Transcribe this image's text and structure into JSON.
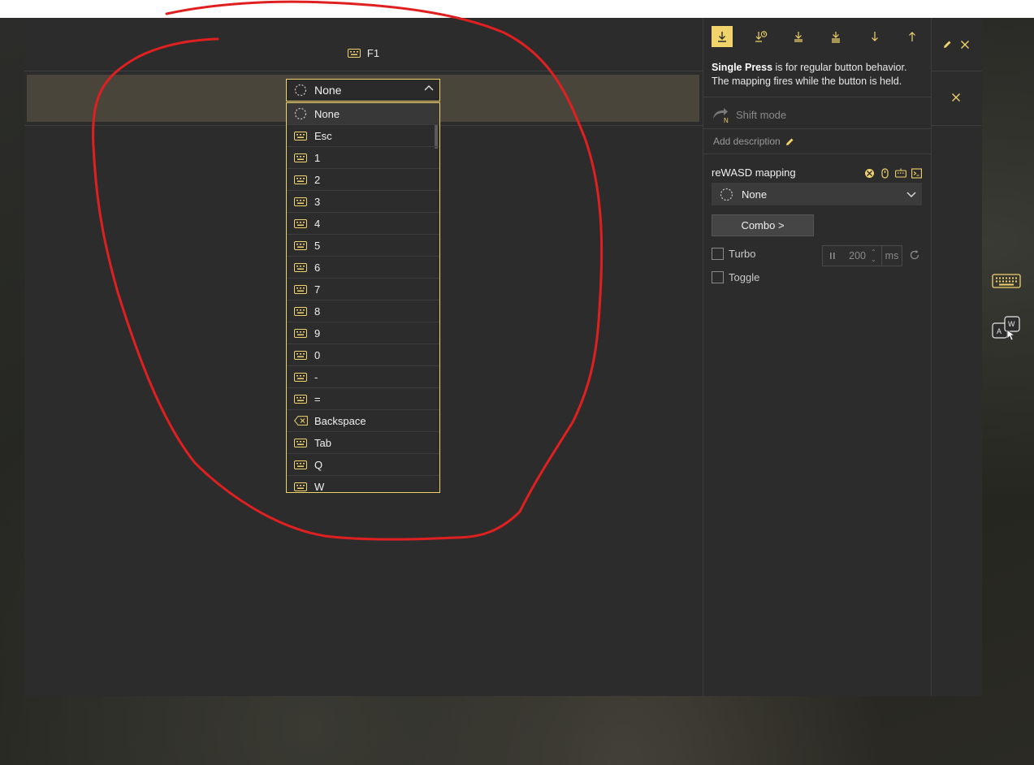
{
  "header": {
    "key_label": "F1"
  },
  "mapping_select": {
    "value": "None"
  },
  "dropdown": {
    "items": [
      {
        "label": "None",
        "icon": "dotted-circle-icon",
        "selected": true
      },
      {
        "label": "Esc",
        "icon": "keyboard-icon"
      },
      {
        "label": "1",
        "icon": "keyboard-icon"
      },
      {
        "label": "2",
        "icon": "keyboard-icon"
      },
      {
        "label": "3",
        "icon": "keyboard-icon"
      },
      {
        "label": "4",
        "icon": "keyboard-icon"
      },
      {
        "label": "5",
        "icon": "keyboard-icon"
      },
      {
        "label": "6",
        "icon": "keyboard-icon"
      },
      {
        "label": "7",
        "icon": "keyboard-icon"
      },
      {
        "label": "8",
        "icon": "keyboard-icon"
      },
      {
        "label": "9",
        "icon": "keyboard-icon"
      },
      {
        "label": "0",
        "icon": "keyboard-icon"
      },
      {
        "label": "-",
        "icon": "keyboard-icon"
      },
      {
        "label": "=",
        "icon": "keyboard-icon"
      },
      {
        "label": "Backspace",
        "icon": "backspace-icon"
      },
      {
        "label": "Tab",
        "icon": "keyboard-icon"
      },
      {
        "label": "Q",
        "icon": "keyboard-icon"
      },
      {
        "label": "W",
        "icon": "keyboard-icon"
      }
    ]
  },
  "side_panel": {
    "mode_buttons": [
      {
        "name": "single-press",
        "active": true
      },
      {
        "name": "long-press"
      },
      {
        "name": "double-press"
      },
      {
        "name": "triple-press"
      },
      {
        "name": "start-press"
      },
      {
        "name": "release"
      }
    ],
    "description_bold": "Single Press",
    "description_rest": " is for regular button behavior. The mapping fires while the button is held.",
    "shift_mode": "Shift mode",
    "shift_badge": "N",
    "add_description": "Add description",
    "rewasd_title": "reWASD mapping",
    "rewasd_value": "None",
    "combo_label": "Combo >",
    "turbo_label": "Turbo",
    "turbo_value": "200",
    "turbo_unit": "ms",
    "toggle_label": "Toggle"
  },
  "colors": {
    "accent": "#f1d36b",
    "panel": "#2c2c2c",
    "band": "#4a453a",
    "annotation": "#e02020"
  }
}
